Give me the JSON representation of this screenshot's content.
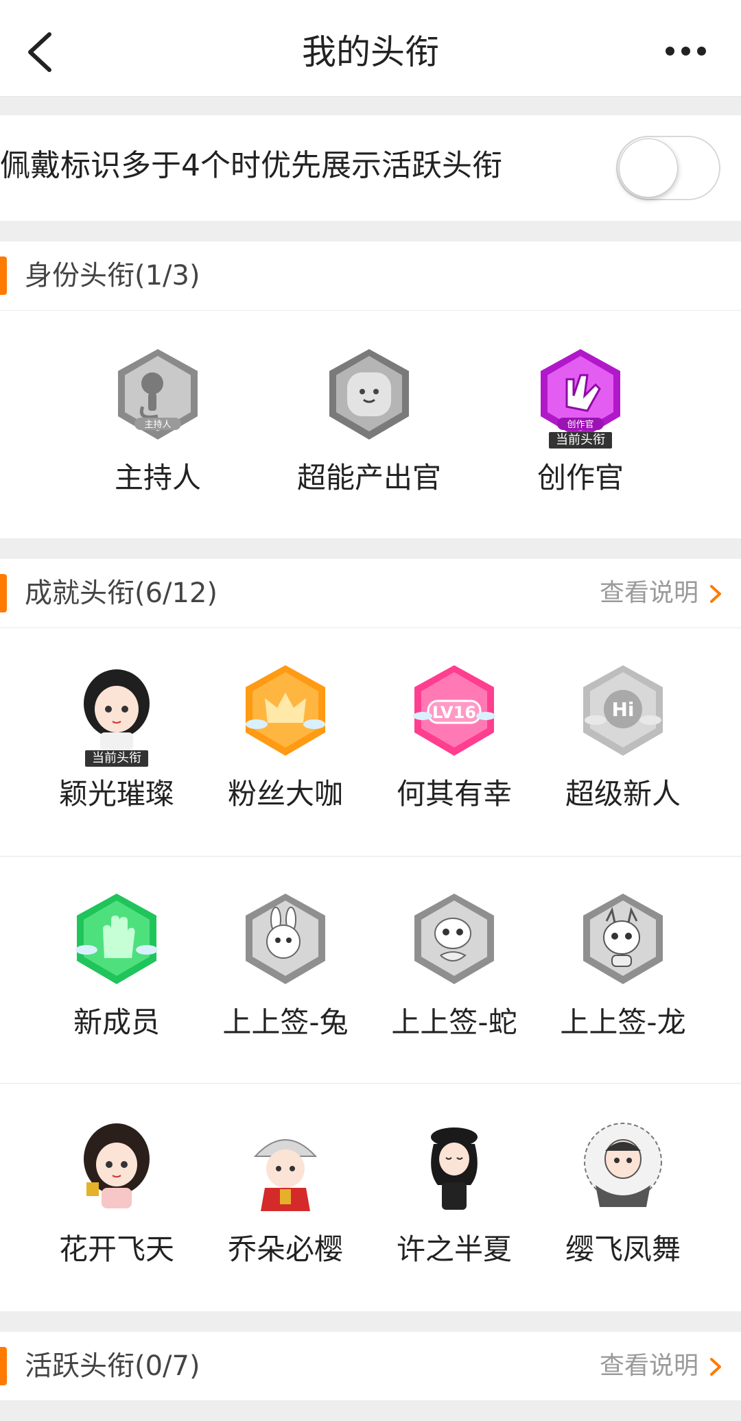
{
  "header": {
    "title": "我的头衔"
  },
  "setting": {
    "text": "佩戴标识多于4个时优先展示活跃头衔",
    "toggle_on": false
  },
  "identity": {
    "title": "身份头衔(1/3)",
    "items": [
      {
        "label": "主持人",
        "icon": "host-microphone-badge-icon",
        "current": false
      },
      {
        "label": "超能产出官",
        "icon": "super-producer-badge-icon",
        "current": false
      },
      {
        "label": "创作官",
        "icon": "creator-badge-icon",
        "current": true,
        "tag": "当前头衔"
      }
    ]
  },
  "achievement": {
    "title": "成就头衔(6/12)",
    "info": "查看说明",
    "items": [
      {
        "label": "颖光璀璨",
        "icon": "avatar-girl-badge-icon",
        "current": true,
        "tag": "当前头衔"
      },
      {
        "label": "粉丝大咖",
        "icon": "crown-badge-icon"
      },
      {
        "label": "何其有幸",
        "icon": "lv16-badge-icon",
        "badge_text": "LV16"
      },
      {
        "label": "超级新人",
        "icon": "hi-badge-icon",
        "badge_text": "Hi"
      },
      {
        "label": "新成员",
        "icon": "hand-badge-icon"
      },
      {
        "label": "上上签-兔",
        "icon": "rabbit-badge-icon"
      },
      {
        "label": "上上签-蛇",
        "icon": "snake-badge-icon"
      },
      {
        "label": "上上签-龙",
        "icon": "dragon-badge-icon"
      },
      {
        "label": "花开飞天",
        "icon": "avatar-flying-badge-icon"
      },
      {
        "label": "乔朵必樱",
        "icon": "avatar-headdress-badge-icon"
      },
      {
        "label": "许之半夏",
        "icon": "avatar-beret-badge-icon"
      },
      {
        "label": "缨飞凤舞",
        "icon": "avatar-phoenix-badge-icon"
      }
    ]
  },
  "active": {
    "title": "活跃头衔(0/7)",
    "info": "查看说明"
  },
  "colors": {
    "accent": "#ff7a00",
    "background": "#eeeeee"
  }
}
